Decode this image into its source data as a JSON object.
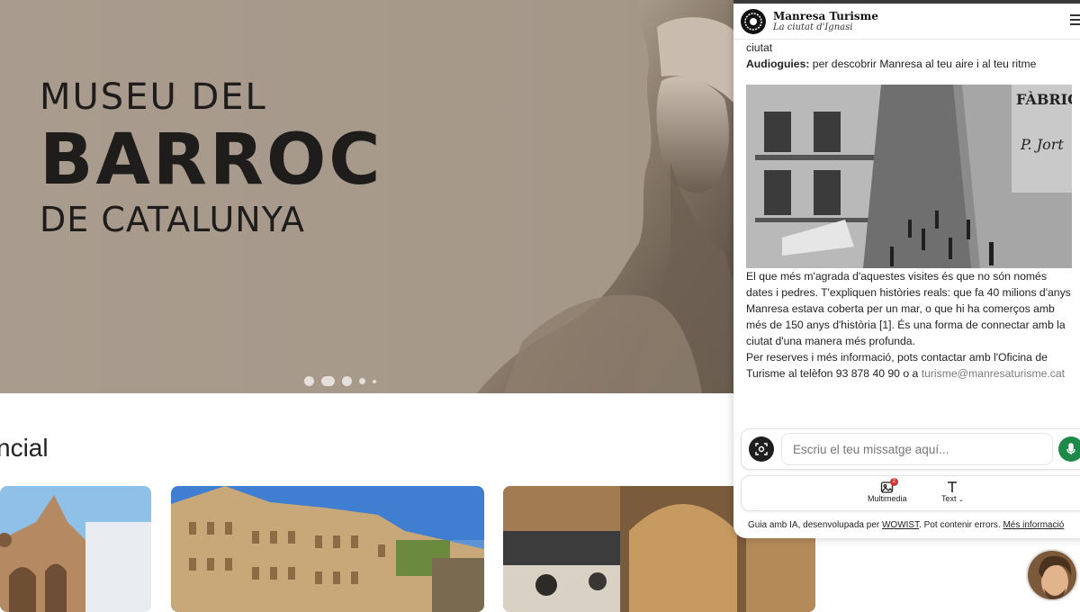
{
  "hero": {
    "line1": "MUSEU DEL",
    "line2": "BARROC",
    "line3": "DE CATALUNYA",
    "carousel_dots": 5,
    "active_dot": 2
  },
  "section": {
    "title": "ncial"
  },
  "chat": {
    "brand_name": "Manresa Turisme",
    "brand_tagline": "La ciutat d'Ignasi",
    "top_fragment": "ciutat",
    "audio_label": "Audioguies:",
    "audio_text": " per descobrir Manresa al teu aire i al teu ritme",
    "photo_signs": [
      "FÀBRICA",
      "P. Jort"
    ],
    "description": "El que més m'agrada d'aquestes visites és que no són només dates i pedres. T'expliquen històries reals: que fa 40 milions d'anys Manresa estava coberta per un mar, o que hi ha comerços amb més de 150 anys d'història [1]. És una forma de connectar amb la ciutat d'una manera més profunda.",
    "contact_text": "Per reserves i més informació, pots contactar amb l'Oficina de Turisme al telèfon 93 878 40 90 o a ",
    "contact_email": "turisme@manresaturisme.cat",
    "input_placeholder": "Escriu el teu missatge aquí...",
    "tool_multimedia": "Multimedia",
    "tool_text": "Text",
    "multimedia_badge": "2",
    "footer_prefix": "Guia amb IA, desenvolupada per ",
    "footer_link": "WOWIST",
    "footer_middle": ". Pot contenir errors. ",
    "footer_more": "Més informació"
  },
  "colors": {
    "hero_bg": "#a59889",
    "mic_green": "#1d8a4a",
    "badge_red": "#d0352f"
  },
  "icons": [
    "menu-icon",
    "camera-scan-icon",
    "microphone-icon",
    "image-icon",
    "text-icon",
    "chevron-down-icon"
  ]
}
